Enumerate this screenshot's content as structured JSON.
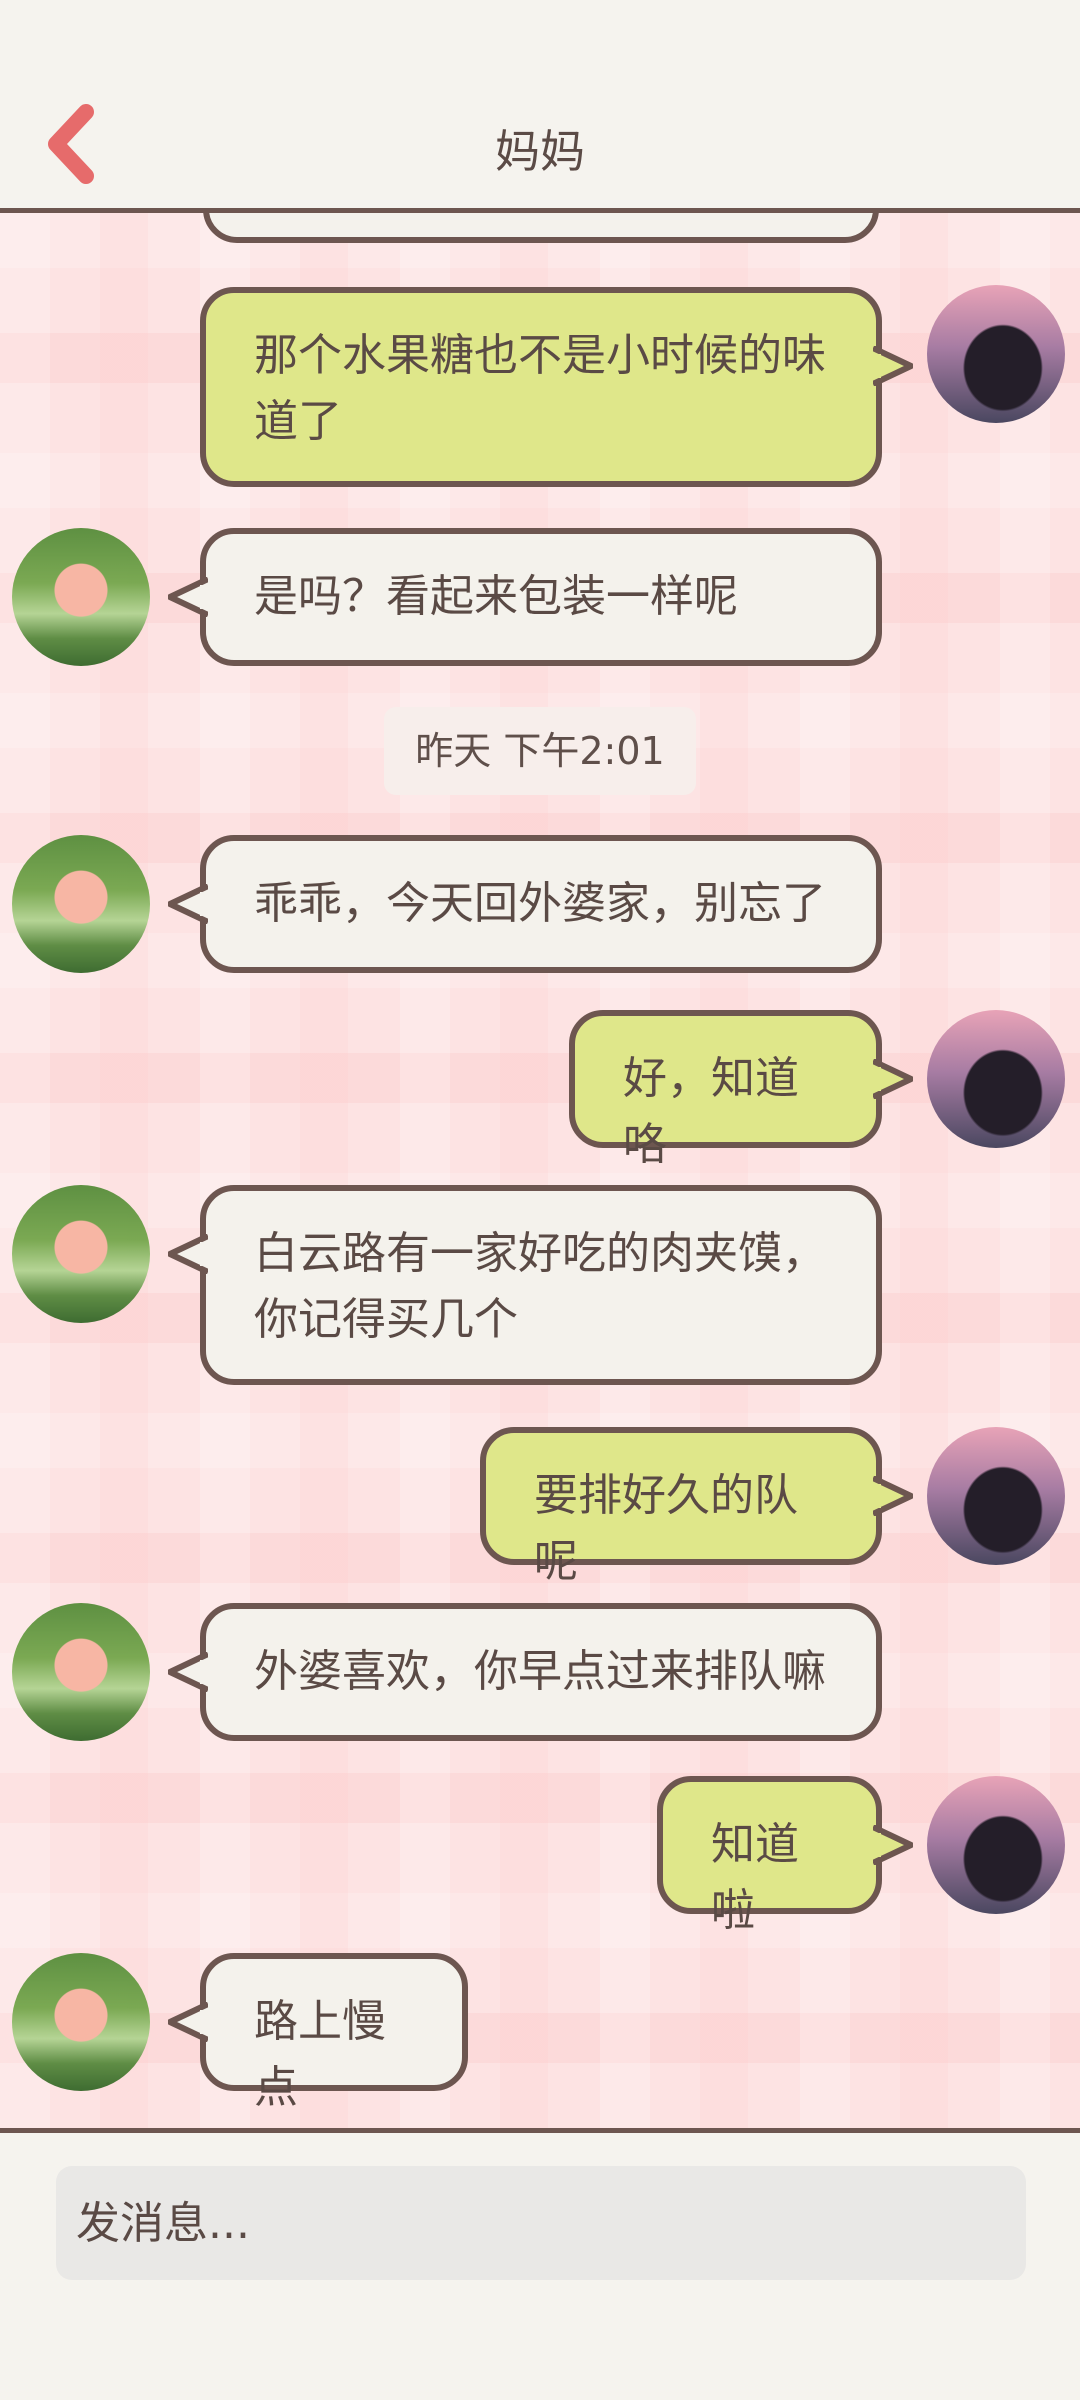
{
  "header": {
    "title": "妈妈",
    "back_icon": "chevron-left-icon"
  },
  "messages": [
    {
      "sender": "mom",
      "text": ""
    },
    {
      "sender": "me",
      "text": "那个水果糖也不是小时候的味道了"
    },
    {
      "sender": "mom",
      "text": "是吗？看起来包装一样呢"
    },
    {
      "sender": "mom",
      "text": "乖乖，今天回外婆家，别忘了"
    },
    {
      "sender": "me",
      "text": "好，知道咯"
    },
    {
      "sender": "mom",
      "text": "白云路有一家好吃的肉夹馍，你记得买几个"
    },
    {
      "sender": "me",
      "text": "要排好久的队呢"
    },
    {
      "sender": "mom",
      "text": "外婆喜欢，你早点过来排队嘛"
    },
    {
      "sender": "me",
      "text": "知道啦"
    },
    {
      "sender": "mom",
      "text": "路上慢点"
    }
  ],
  "timestamp": "昨天 下午2:01",
  "input": {
    "placeholder": "发消息..."
  },
  "colors": {
    "my_bubble": "#dfe78a",
    "other_bubble": "#f4f2ec",
    "border": "#6d5650",
    "back_arrow": "#e66b6b"
  }
}
